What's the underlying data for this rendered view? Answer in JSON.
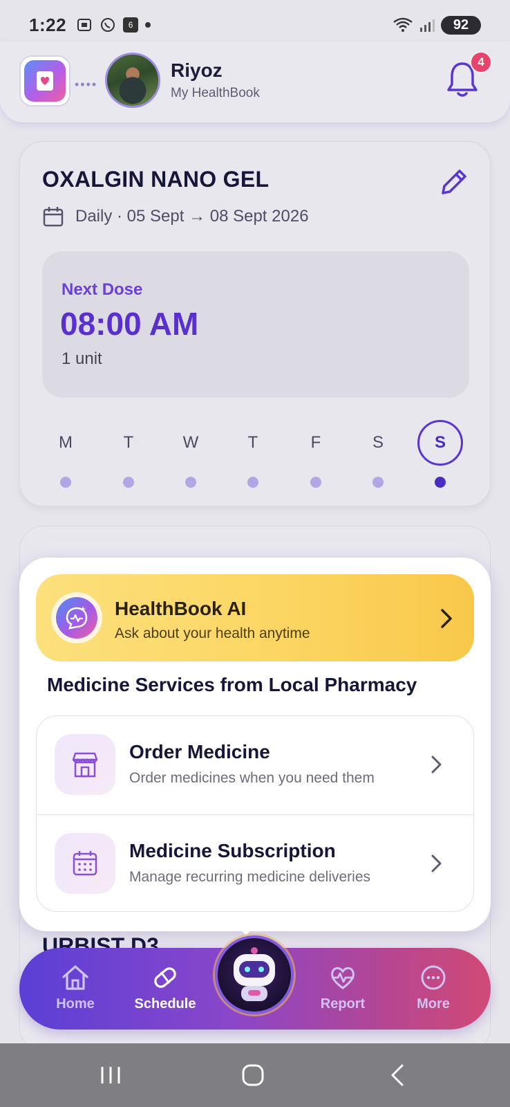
{
  "status_bar": {
    "time": "1:22",
    "notification_count_icon": "6",
    "battery": "92"
  },
  "header": {
    "user_name": "Riyoz",
    "app_subtitle": "My HealthBook",
    "notification_badge": "4"
  },
  "medicine": {
    "name": "OXALGIN NANO GEL",
    "schedule": "Daily · 05 Sept → 08 Sept 2026",
    "next_dose_label": "Next Dose",
    "next_dose_time": "08:00 AM",
    "dose_amount": "1 unit",
    "week_days": [
      "M",
      "T",
      "W",
      "T",
      "F",
      "S",
      "S"
    ],
    "active_day_index": 6
  },
  "background_card": {
    "title_partial": "URBIST D3"
  },
  "popup": {
    "ai_title": "HealthBook AI",
    "ai_subtitle": "Ask about your health anytime",
    "section_title": "Medicine Services from Local Pharmacy",
    "services": [
      {
        "title": "Order Medicine",
        "subtitle": "Order medicines when you need them",
        "icon": "store-icon"
      },
      {
        "title": "Medicine Subscription",
        "subtitle": "Manage recurring medicine deliveries",
        "icon": "calendar-grid-icon"
      }
    ]
  },
  "bottom_nav": {
    "items": [
      {
        "label": "Home",
        "icon": "home-icon"
      },
      {
        "label": "Schedule",
        "icon": "pill-icon"
      },
      {
        "label": "Report",
        "icon": "heart-pulse-icon"
      },
      {
        "label": "More",
        "icon": "more-icon"
      }
    ],
    "active": "Schedule"
  },
  "colors": {
    "accent": "#5a2fd0",
    "ai_banner": "#fcd766",
    "badge": "#e8436a"
  }
}
